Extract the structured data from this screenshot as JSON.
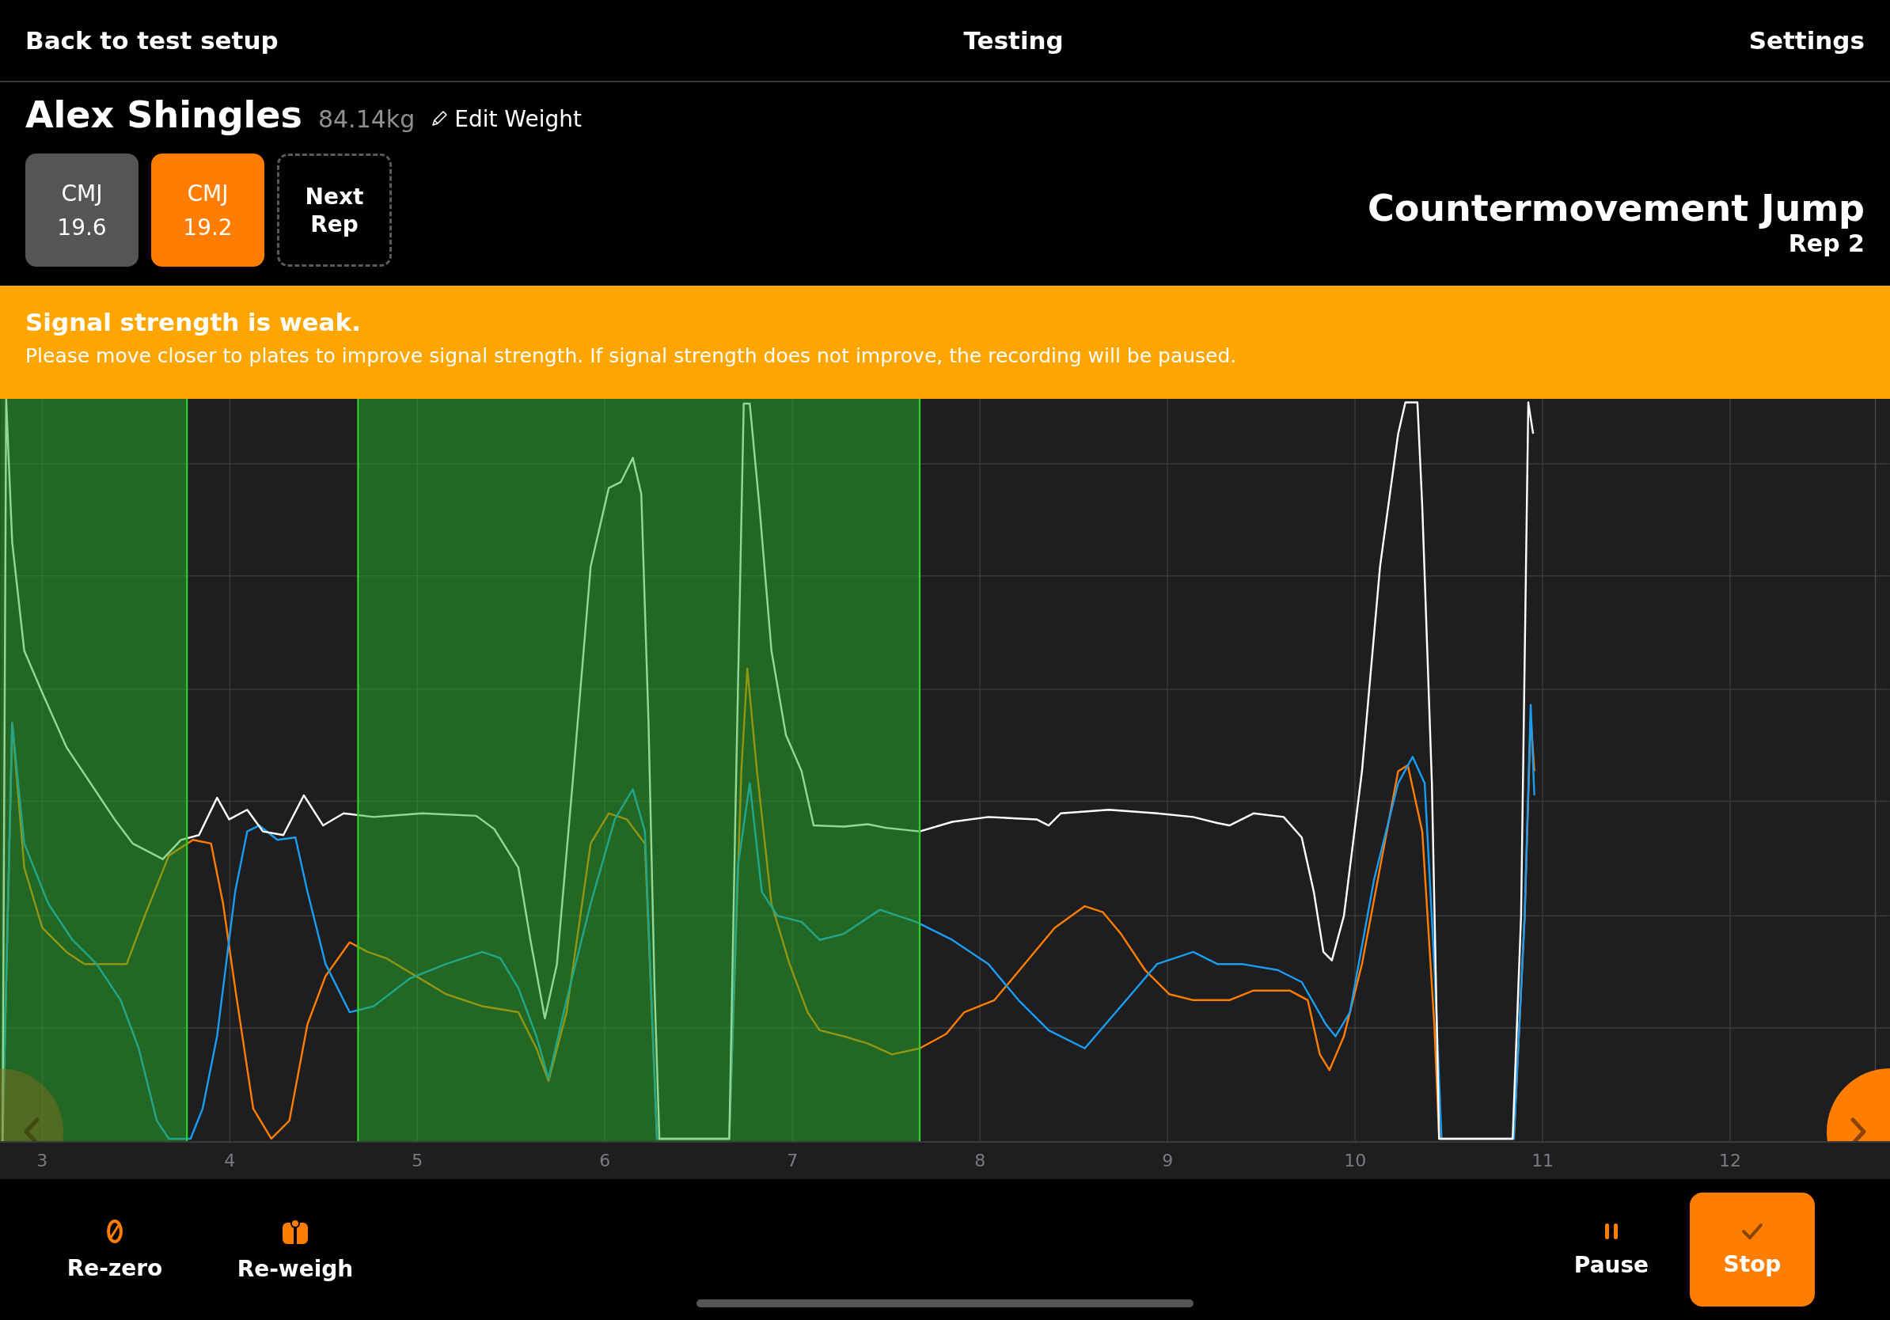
{
  "top_bar": {
    "back": "Back to test setup",
    "title": "Testing",
    "settings": "Settings"
  },
  "athlete": {
    "name": "Alex Shingles",
    "weight": "84.14kg",
    "edit": "Edit Weight"
  },
  "reps": [
    {
      "label": "CMJ",
      "value": "19.6",
      "selected": false
    },
    {
      "label": "CMJ",
      "value": "19.2",
      "selected": true
    }
  ],
  "next_rep": {
    "label": "Next\nRep"
  },
  "test": {
    "name": "Countermovement Jump",
    "rep": "Rep 2"
  },
  "alert": {
    "title": "Signal strength is weak.",
    "message": "Please move closer to plates to improve signal strength. If signal strength does not improve, the recording will be paused."
  },
  "chart": {
    "x_tick_labels": [
      "3",
      "4",
      "5",
      "6",
      "7",
      "8",
      "9",
      "10",
      "11",
      "12"
    ]
  },
  "actions": [
    {
      "kind": "rezero",
      "label": "Re-zero"
    },
    {
      "kind": "reweigh",
      "label": "Re-weigh"
    },
    {
      "kind": "pause",
      "label": "Pause"
    },
    {
      "kind": "stop",
      "label": "Stop"
    }
  ]
}
